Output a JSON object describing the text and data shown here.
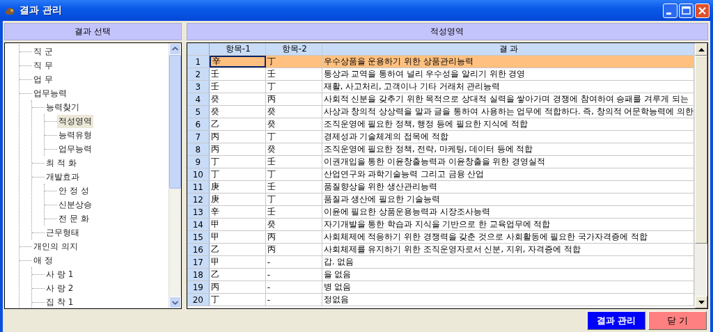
{
  "window": {
    "title": "결과 관리"
  },
  "left_panel": {
    "header": "결과 선택",
    "tree": [
      {
        "label": "직 군",
        "selected": false
      },
      {
        "label": "직 무",
        "selected": false
      },
      {
        "label": "업 무",
        "selected": false
      },
      {
        "label": "업무능력",
        "selected": false,
        "children": [
          {
            "label": "능력찾기",
            "selected": false,
            "children": [
              {
                "label": "적성영역",
                "selected": true
              },
              {
                "label": "능력유형",
                "selected": false
              },
              {
                "label": "업무능력",
                "selected": false
              }
            ]
          },
          {
            "label": "최 적 화",
            "selected": false
          },
          {
            "label": "개발효과",
            "selected": false,
            "children": [
              {
                "label": "안 정 성",
                "selected": false
              },
              {
                "label": "신분상승",
                "selected": false
              },
              {
                "label": "전 문 화",
                "selected": false
              }
            ]
          },
          {
            "label": "근무형태",
            "selected": false
          }
        ]
      },
      {
        "label": "개인의 의지",
        "selected": false
      },
      {
        "label": "애 정",
        "selected": false,
        "children": [
          {
            "label": "사 랑 1",
            "selected": false
          },
          {
            "label": "사 랑 2",
            "selected": false
          },
          {
            "label": "집 착 1",
            "selected": false
          }
        ]
      }
    ]
  },
  "right_panel": {
    "header": "적성영역",
    "table": {
      "columns": [
        "항목-1",
        "항목-2",
        "결 과"
      ],
      "rows": [
        {
          "number": "1",
          "item_1": "辛",
          "item_2": "丁",
          "result": "우수상품을 운용하기 위한 상품관리능력",
          "selected": true
        },
        {
          "number": "2",
          "item_1": "壬",
          "item_2": "壬",
          "result": "통상과 교역을 통하여 널리 우수성을 알리기 위한 경영",
          "selected": false
        },
        {
          "number": "3",
          "item_1": "壬",
          "item_2": "丁",
          "result": "재활, 사고처리, 고객이나 기타 거래처 관리능력",
          "selected": false
        },
        {
          "number": "4",
          "item_1": "癸",
          "item_2": "丙",
          "result": "사회적 신분을 갖추기 위한 목적으로 상대적 실력을 쌓아가며 경쟁에 참여하여 승패를 겨루게 되는",
          "selected": false
        },
        {
          "number": "5",
          "item_1": "癸",
          "item_2": "癸",
          "result": "사상과 창의적 상상력을 말과 글을 통하여 사용하는 업무에 적합하다. 즉, 창의적 어문학능력에 의한",
          "selected": false
        },
        {
          "number": "6",
          "item_1": "乙",
          "item_2": "癸",
          "result": "조직운영에 필요한 정책, 행정 등에 필요한 지식에 적합",
          "selected": false
        },
        {
          "number": "7",
          "item_1": "丙",
          "item_2": "丁",
          "result": "경제성과 기술체계의 접목에 적합",
          "selected": false
        },
        {
          "number": "8",
          "item_1": "丙",
          "item_2": "癸",
          "result": "조직운영에 필요한 정책, 전략, 마케팅, 데이터 등에 적합",
          "selected": false
        },
        {
          "number": "9",
          "item_1": "丁",
          "item_2": "壬",
          "result": "이권개입을 통한 이윤창출능력과 이윤창출을 위한 경영실적",
          "selected": false
        },
        {
          "number": "10",
          "item_1": "丁",
          "item_2": "丁",
          "result": "산업연구와 과학기술능력 그리고 금융 산업",
          "selected": false
        },
        {
          "number": "11",
          "item_1": "庚",
          "item_2": "壬",
          "result": "품질향상을 위한 생산관리능력",
          "selected": false
        },
        {
          "number": "12",
          "item_1": "庚",
          "item_2": "丁",
          "result": "품질과 생산에 필요한 기술능력",
          "selected": false
        },
        {
          "number": "13",
          "item_1": "辛",
          "item_2": "壬",
          "result": "이윤에 필요한 상품운용능력과 시장조사능력",
          "selected": false
        },
        {
          "number": "14",
          "item_1": "甲",
          "item_2": "癸",
          "result": "자기개발을 통한 학습과 지식을 기반으로 한 교육업무에 적합",
          "selected": false
        },
        {
          "number": "15",
          "item_1": "甲",
          "item_2": "丙",
          "result": "사회체제에 적응하기 위한 경쟁력을 갖춘 것으로 사회활동에 필요한 국가자격증에 적합",
          "selected": false
        },
        {
          "number": "16",
          "item_1": "乙",
          "item_2": "丙",
          "result": "사회체제를 유지하기 위한 조직운영자로서 신분, 지위, 자격증에 적합",
          "selected": false
        },
        {
          "number": "17",
          "item_1": "甲",
          "item_2": "-",
          "result": "갑. 없음",
          "selected": false
        },
        {
          "number": "18",
          "item_1": "乙",
          "item_2": "-",
          "result": "을 없음",
          "selected": false
        },
        {
          "number": "19",
          "item_1": "丙",
          "item_2": "-",
          "result": "병 없음",
          "selected": false
        },
        {
          "number": "20",
          "item_1": "丁",
          "item_2": "-",
          "result": "정없음",
          "selected": false
        }
      ]
    }
  },
  "buttons": [
    {
      "kind": "primary",
      "label": "결과 관리"
    },
    {
      "kind": "close",
      "label": "닫 기"
    }
  ]
}
